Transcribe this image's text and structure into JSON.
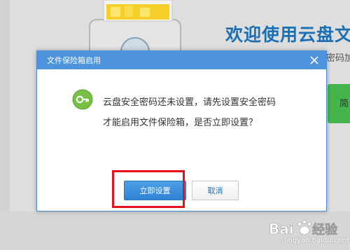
{
  "background": {
    "headline": "欢迎使用云盘文",
    "subtext": "密码加",
    "side_label": "简"
  },
  "dialog": {
    "title": "文件保险箱启用",
    "message_line1": "云盘安全密码还未设置，请先设置安全密码",
    "message_line2": "才能启用文件保险箱，是否立即设置？",
    "primary_button": "立即设置",
    "cancel_button": "取消",
    "icon": "key-icon"
  },
  "watermark": {
    "brand": "Bai经验",
    "url": "jingyan.baidu.com"
  },
  "colors": {
    "titlebar": "#4d94dc",
    "primary_button": "#3a8ee0",
    "highlight": "#e8101d",
    "key_icon": "#76c043"
  }
}
